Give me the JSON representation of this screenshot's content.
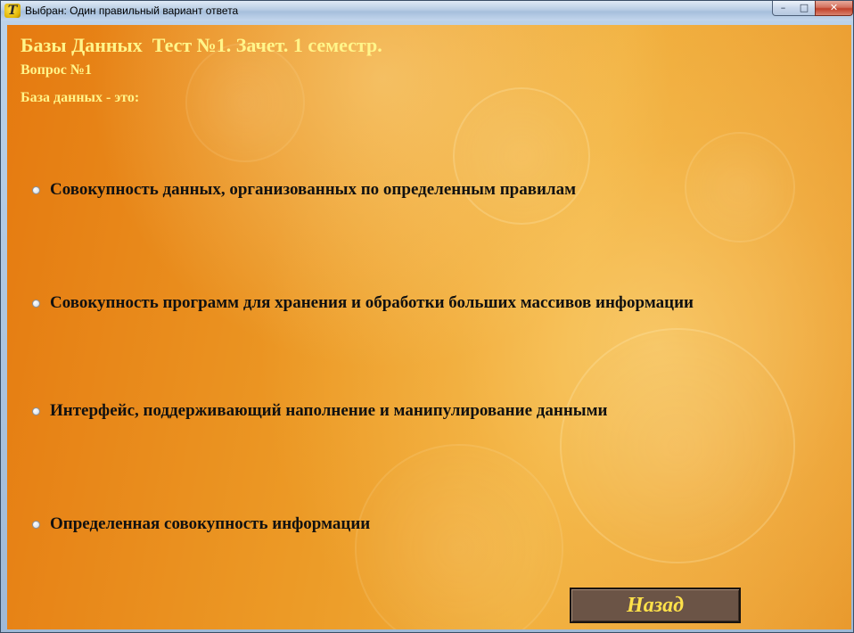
{
  "window": {
    "title": "Выбран: Один правильный вариант ответа",
    "icon": "app-icon",
    "controls": {
      "minimize": "–",
      "maximize": "□",
      "close": "✕"
    }
  },
  "test": {
    "heading": "Базы Данных  Тест №1. Зачет. 1 семестр.",
    "question_number": "Вопрос №1",
    "question_text": "База данных - это:",
    "options": [
      {
        "label": "Совокупность данных, организованных по определенным правилам",
        "selected": false
      },
      {
        "label": "Совокупность программ для хранения и обработки больших массивов информации",
        "selected": false
      },
      {
        "label": "Интерфейс, поддерживающий наполнение и манипулирование данными",
        "selected": false
      },
      {
        "label": "Определенная совокупность информации",
        "selected": false
      }
    ],
    "back_button_label": "Назад"
  },
  "colors": {
    "heading_text": "#fff58a",
    "option_text": "#111111",
    "button_background": "#6b5446",
    "button_text": "#ffe24a",
    "background_orange": "#ec9a26"
  }
}
